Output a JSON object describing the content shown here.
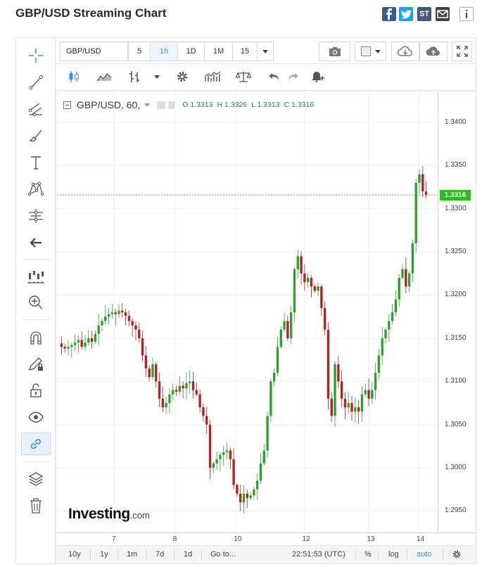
{
  "header": {
    "title": "GBP/USD Streaming Chart",
    "share_icons": [
      "facebook-icon",
      "twitter-icon",
      "stocktwits-icon",
      "email-icon",
      "info-icon"
    ],
    "stocktwits_label": "ST"
  },
  "toolbar": {
    "symbol": "GBP/USD",
    "intervals": [
      "5",
      "1h",
      "1D",
      "1M",
      "15"
    ],
    "active_interval": "1h"
  },
  "legend": {
    "symbol_label": "GBP/USD, 60,",
    "open": "O 1.3313",
    "high": "H 1.3326",
    "low": "L 1.3313",
    "close": "C 1.3316"
  },
  "price_tag": "1.3316",
  "watermark": {
    "brand": "Investing",
    "suffix": ".com"
  },
  "bottom_bar": {
    "ranges": [
      "10y",
      "1y",
      "1m",
      "7d",
      "1d"
    ],
    "goto": "Go to...",
    "time": "22:51:53 (UTC)",
    "percent": "%",
    "log": "log",
    "auto": "auto"
  },
  "colors": {
    "up": "#2ca02c",
    "down": "#b22222",
    "price_line": "#2cbd1f",
    "accent": "#3a8fd6"
  },
  "chart_data": {
    "type": "candlestick",
    "title": "",
    "xlabel": "",
    "ylabel": "",
    "x_ticks": [
      "7",
      "8",
      "10",
      "12",
      "13",
      "14"
    ],
    "y_ticks": [
      "1.3400",
      "1.3350",
      "1.3300",
      "1.3250",
      "1.3200",
      "1.3150",
      "1.3100",
      "1.3050",
      "1.3000",
      "1.2950"
    ],
    "ylim": [
      1.2925,
      1.3435
    ],
    "last_price": 1.3316,
    "close_series": [
      1.314,
      1.3138,
      1.314,
      1.3142,
      1.3145,
      1.3148,
      1.314,
      1.3145,
      1.315,
      1.3146,
      1.3155,
      1.3165,
      1.317,
      1.3175,
      1.3178,
      1.318,
      1.3178,
      1.3182,
      1.318,
      1.3176,
      1.317,
      1.3165,
      1.316,
      1.315,
      1.313,
      1.3115,
      1.3105,
      1.312,
      1.31,
      1.308,
      1.307,
      1.3075,
      1.3085,
      1.309,
      1.3088,
      1.3095,
      1.3092,
      1.3098,
      1.31,
      1.309,
      1.3085,
      1.307,
      1.306,
      1.305,
      1.3,
      1.3005,
      1.301,
      1.3015,
      1.3018,
      1.302,
      1.301,
      1.298,
      1.297,
      1.296,
      1.297,
      1.2965,
      1.2968,
      1.2975,
      1.2985,
      1.3005,
      1.302,
      1.306,
      1.31,
      1.311,
      1.314,
      1.316,
      1.317,
      1.315,
      1.318,
      1.323,
      1.3245,
      1.3225,
      1.3215,
      1.322,
      1.321,
      1.3205,
      1.321,
      1.3185,
      1.316,
      1.308,
      1.306,
      1.312,
      1.31,
      1.308,
      1.307,
      1.3075,
      1.3065,
      1.307,
      1.3065,
      1.3085,
      1.309,
      1.308,
      1.309,
      1.311,
      1.313,
      1.315,
      1.316,
      1.317,
      1.318,
      1.3195,
      1.322,
      1.323,
      1.321,
      1.3225,
      1.326,
      1.333,
      1.334,
      1.332,
      1.3316
    ]
  }
}
